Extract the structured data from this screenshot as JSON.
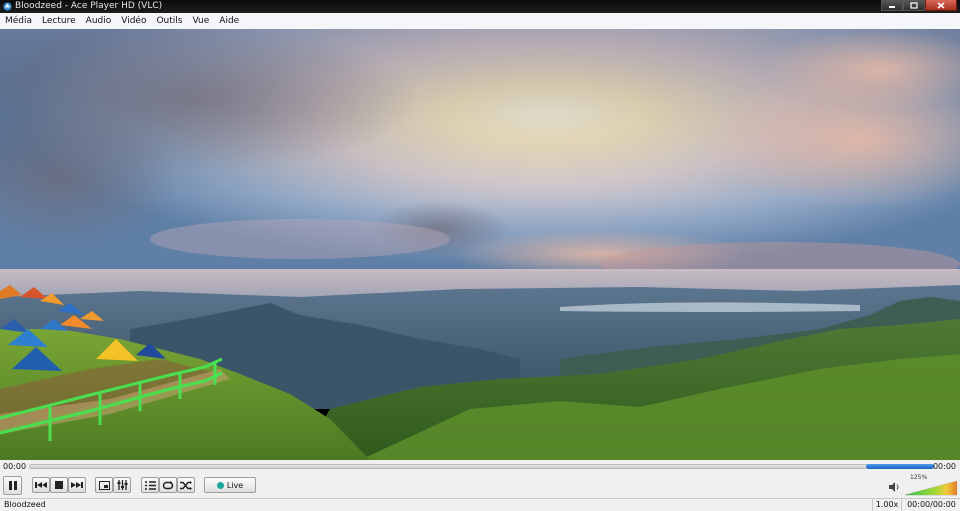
{
  "window": {
    "title": "Bloodzeed - Ace Player HD (VLC)",
    "controls": [
      "minimize-icon",
      "maximize-icon",
      "close-icon"
    ]
  },
  "menu": {
    "items": [
      "Média",
      "Lecture",
      "Audio",
      "Vidéo",
      "Outils",
      "Vue",
      "Aide"
    ]
  },
  "player": {
    "elapsed": "00:00",
    "total": "00:00",
    "buffer_fraction": 0.075,
    "live_label": "Live",
    "live_color": "#1aa8a0",
    "volume_label": "125%",
    "volume_fraction": 1.0
  },
  "status": {
    "media_name": "Bloodzeed",
    "rate": "1.00x",
    "time": "00:00/00:00"
  },
  "colors": {
    "accent": "#1a62c8",
    "titlebar": "#141414"
  }
}
